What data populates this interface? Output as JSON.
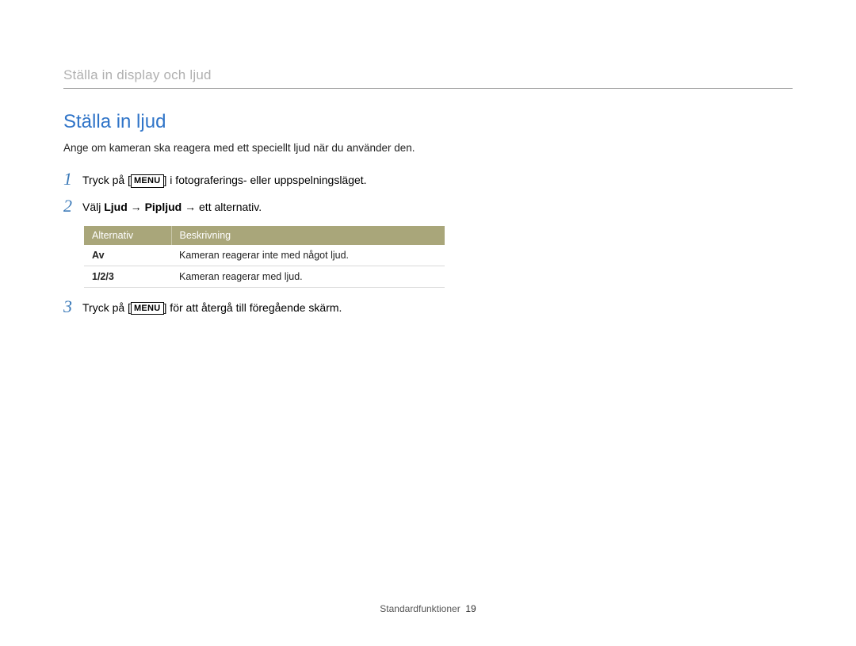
{
  "running_head": "Ställa in display och ljud",
  "section_title": "Ställa in ljud",
  "intro": "Ange om kameran ska reagera med ett speciellt ljud när du använder den.",
  "menu_key": "MENU",
  "steps": {
    "s1": {
      "num": "1",
      "pre": "Tryck på [",
      "post": "] i fotograferings- eller uppspelningsläget."
    },
    "s2": {
      "num": "2",
      "pre": "Välj ",
      "b1": "Ljud",
      "arrow": " → ",
      "b2": "Pipljud",
      "post": " → ett alternativ."
    },
    "s3": {
      "num": "3",
      "pre": "Tryck på [",
      "post": "] för att återgå till föregående skärm."
    }
  },
  "table": {
    "headers": {
      "opt": "Alternativ",
      "desc": "Beskrivning"
    },
    "rows": {
      "r0": {
        "opt": "Av",
        "desc": "Kameran reagerar inte med något ljud."
      },
      "r1": {
        "opt": "1/2/3",
        "desc": "Kameran reagerar med ljud."
      }
    }
  },
  "footer": {
    "section": "Standardfunktioner",
    "page": "19"
  }
}
